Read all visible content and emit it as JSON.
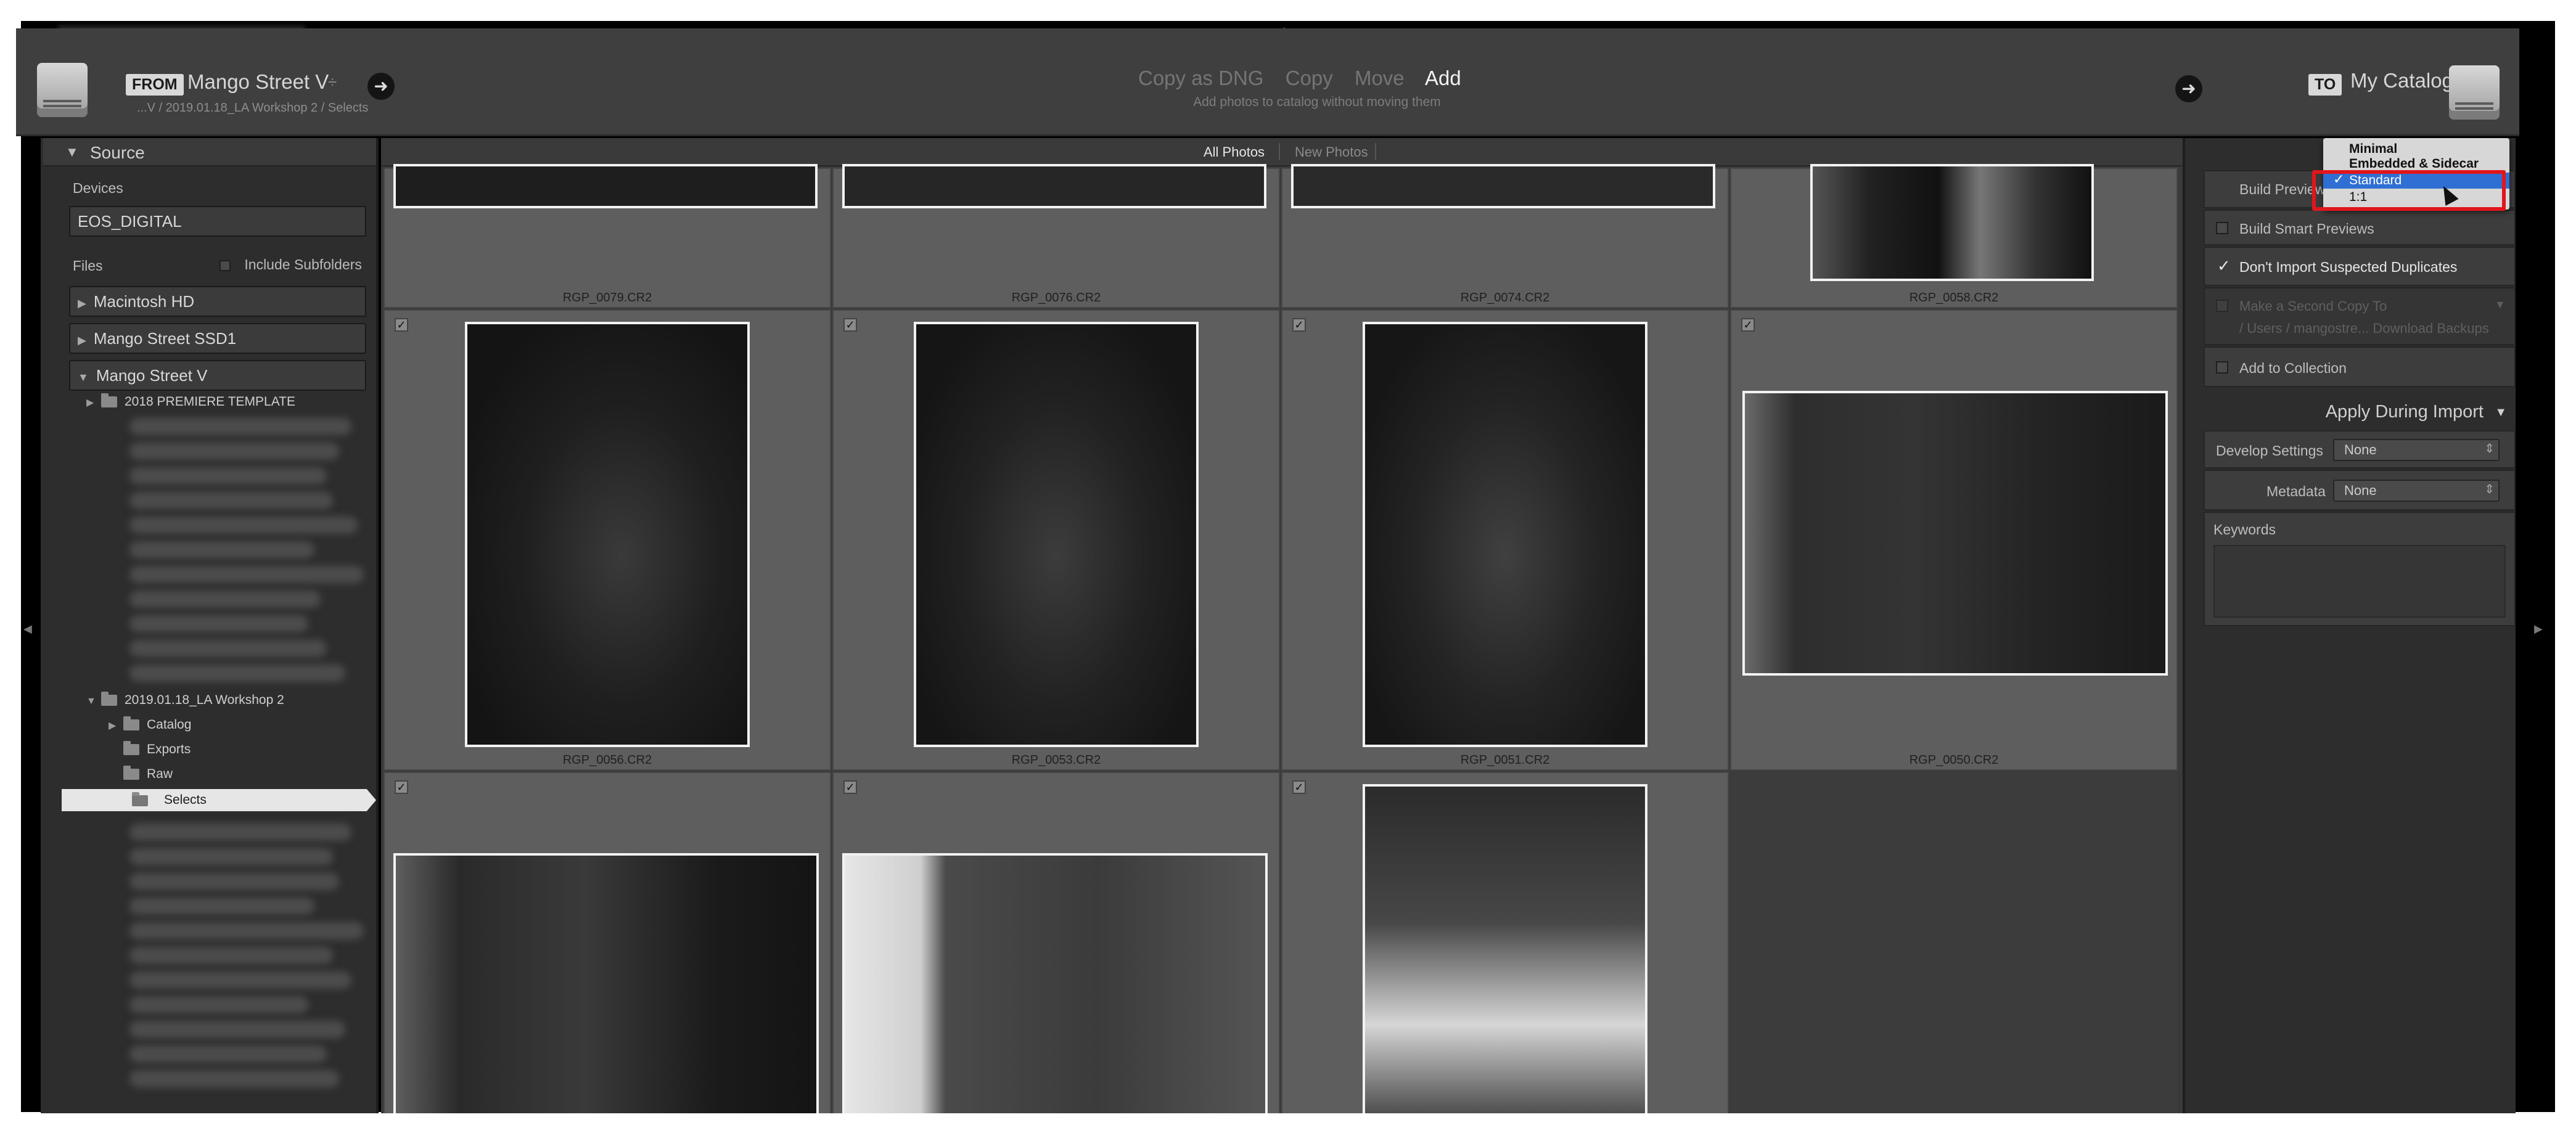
{
  "header": {
    "from_tag": "FROM",
    "source_name": "Mango Street V",
    "source_caret": "÷",
    "source_path": "...V / 2019.01.18_LA Workshop 2 / Selects",
    "modes": [
      "Copy as DNG",
      "Copy",
      "Move",
      "Add"
    ],
    "active_mode": "Add",
    "mode_subtitle": "Add photos to catalog without moving them",
    "to_tag": "TO",
    "destination_name": "My Catalog",
    "arrow_glyph": "➜"
  },
  "source_panel": {
    "title": "Source",
    "devices_label": "Devices",
    "device_name": "EOS_DIGITAL",
    "files_label": "Files",
    "include_subfolders": "Include Subfolders",
    "volumes": [
      "Macintosh HD",
      "Mango Street SSD1",
      "Mango Street V"
    ],
    "folders": {
      "template": "2018 PREMIERE TEMPLATE",
      "workshop": "2019.01.18_LA Workshop 2",
      "subfolders": [
        "Catalog",
        "Exports",
        "Raw",
        "Selects"
      ],
      "selected": "Selects"
    }
  },
  "grid": {
    "tabs": [
      "All Photos",
      "New Photos"
    ],
    "active_tab": "All Photos",
    "check_glyph": "✓",
    "row1": [
      "RGP_0079.CR2",
      "RGP_0076.CR2",
      "RGP_0074.CR2",
      "RGP_0058.CR2"
    ],
    "row2": [
      "RGP_0056.CR2",
      "RGP_0053.CR2",
      "RGP_0051.CR2",
      "RGP_0050.CR2"
    ]
  },
  "right_panel": {
    "build_previews_label": "Build Previews",
    "previews_menu": [
      "Minimal",
      "Embedded & Sidecar",
      "Standard",
      "1:1"
    ],
    "previews_selected": "Standard",
    "build_smart_previews": "Build Smart Previews",
    "dont_import_duplicates": "Don't Import Suspected Duplicates",
    "second_copy": "Make a Second Copy To",
    "second_copy_path": "/ Users / mangostre... Download Backups",
    "add_to_collection": "Add to Collection",
    "apply_title": "Apply During Import",
    "develop_settings_label": "Develop Settings",
    "develop_settings_value": "None",
    "metadata_label": "Metadata",
    "metadata_value": "None",
    "keywords_label": "Keywords"
  },
  "colors": {
    "selection_blue": "#2f6fd4",
    "highlight_red": "#e0161c"
  }
}
